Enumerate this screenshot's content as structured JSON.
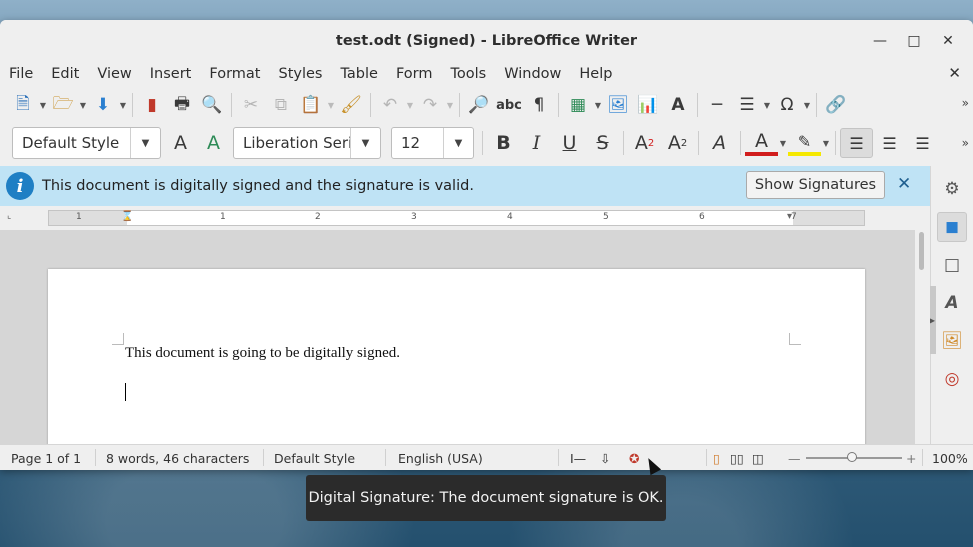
{
  "window": {
    "title": "test.odt (Signed) - LibreOffice Writer"
  },
  "menubar": {
    "items": [
      "File",
      "Edit",
      "View",
      "Insert",
      "Format",
      "Styles",
      "Table",
      "Form",
      "Tools",
      "Window",
      "Help"
    ]
  },
  "formatting": {
    "paragraph_style": "Default Style",
    "font_name": "Liberation Seri",
    "font_size": "12"
  },
  "infobar": {
    "message": "This document is digitally signed and the signature is valid.",
    "show_signatures_label": "Show Signatures"
  },
  "ruler": {
    "numbers": [
      "1",
      "1",
      "2",
      "3",
      "4",
      "5",
      "6",
      "7"
    ]
  },
  "document": {
    "text": "This document is going to be digitally signed."
  },
  "statusbar": {
    "page": "Page 1 of 1",
    "word_count": "8 words, 46 characters",
    "page_style": "Default Style",
    "language": "English (USA)",
    "zoom": "100%"
  },
  "tooltip": {
    "text": "Digital Signature: The document signature is OK."
  },
  "colors": {
    "infobar_bg": "#bfe3f5",
    "info_icon": "#1f7fc4",
    "font_color_bar": "#d11d1d",
    "highlight_bar": "#f5e800"
  }
}
